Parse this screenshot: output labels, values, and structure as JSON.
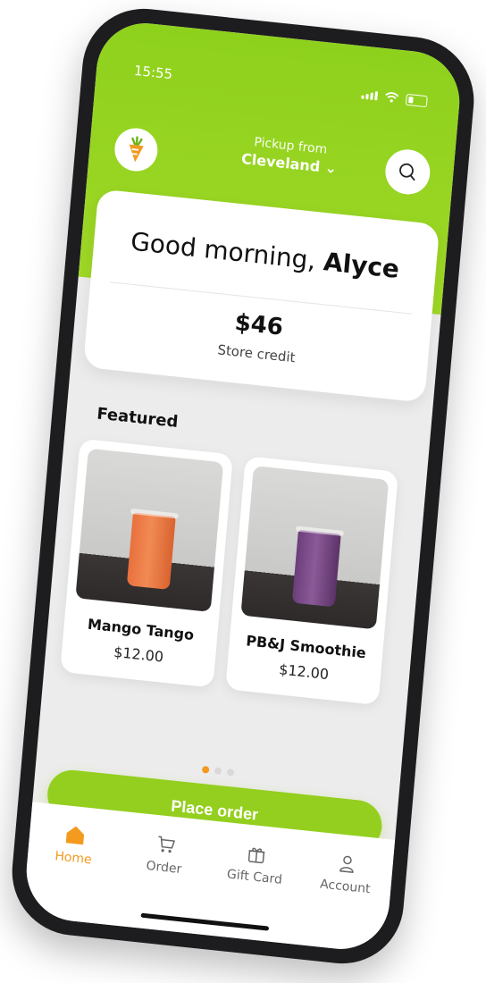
{
  "status_bar": {
    "time": "15:55"
  },
  "header": {
    "pickup_label": "Pickup from",
    "location": "Cleveland",
    "logo_icon": "carrot-icon",
    "search_icon": "search-icon"
  },
  "greeting": {
    "prefix": "Good morning, ",
    "name": "Alyce",
    "credit_amount": "$46",
    "credit_label": "Store credit"
  },
  "featured": {
    "title": "Featured",
    "items": [
      {
        "name": "Mango Tango",
        "price": "$12.00",
        "cup_color": "#ef7a45"
      },
      {
        "name": "PB&J Smoothie",
        "price": "$12.00",
        "cup_color": "#7a4a88"
      }
    ],
    "carousel": {
      "count": 3,
      "active_index": 0
    }
  },
  "actions": {
    "place_order": "Place order"
  },
  "tabbar": {
    "items": [
      {
        "label": "Home",
        "icon": "home-icon",
        "active": true
      },
      {
        "label": "Order",
        "icon": "cart-icon",
        "active": false
      },
      {
        "label": "Gift Card",
        "icon": "gift-icon",
        "active": false
      },
      {
        "label": "Account",
        "icon": "account-icon",
        "active": false
      }
    ]
  },
  "colors": {
    "brand_green": "#94cf1f",
    "accent_orange": "#f39a1f"
  }
}
